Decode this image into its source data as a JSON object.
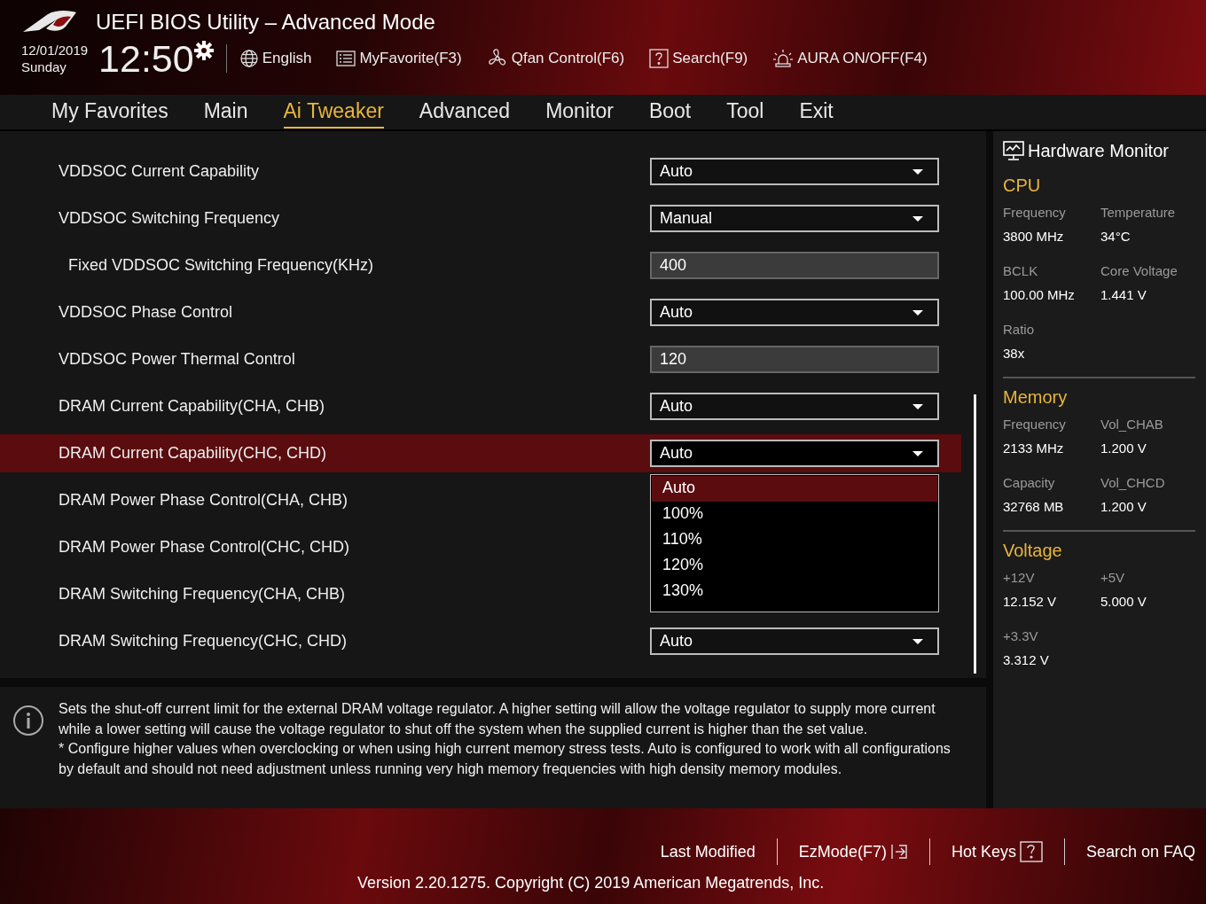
{
  "header": {
    "title": "UEFI BIOS Utility – Advanced Mode",
    "date": "12/01/2019",
    "day": "Sunday",
    "time": "12:50",
    "tools": [
      {
        "label": "English"
      },
      {
        "label": "MyFavorite(F3)"
      },
      {
        "label": "Qfan Control(F6)"
      },
      {
        "label": "Search(F9)"
      },
      {
        "label": "AURA ON/OFF(F4)"
      }
    ]
  },
  "tabs": [
    {
      "label": "My Favorites",
      "selected": false
    },
    {
      "label": "Main",
      "selected": false
    },
    {
      "label": "Ai Tweaker",
      "selected": true
    },
    {
      "label": "Advanced",
      "selected": false
    },
    {
      "label": "Monitor",
      "selected": false
    },
    {
      "label": "Boot",
      "selected": false
    },
    {
      "label": "Tool",
      "selected": false
    },
    {
      "label": "Exit",
      "selected": false
    }
  ],
  "settings": [
    {
      "label": "VDDSOC Current Capability",
      "kind": "dropdown",
      "value": "Auto",
      "selected": false
    },
    {
      "label": "VDDSOC Switching Frequency",
      "kind": "dropdown",
      "value": "Manual",
      "selected": false,
      "children": [
        {
          "label": "Fixed VDDSOC Switching Frequency(KHz)",
          "kind": "number",
          "value": "400",
          "selected": false
        }
      ]
    },
    {
      "label": "VDDSOC Phase Control",
      "kind": "dropdown",
      "value": "Auto",
      "selected": false
    },
    {
      "label": "VDDSOC Power Thermal Control",
      "kind": "number",
      "value": "120",
      "selected": false
    },
    {
      "label": "DRAM Current Capability(CHA, CHB)",
      "kind": "dropdown",
      "value": "Auto",
      "selected": false
    },
    {
      "label": "DRAM Current Capability(CHC, CHD)",
      "kind": "dropdown",
      "value": "Auto",
      "selected": true,
      "options": [
        {
          "label": "Auto",
          "selected": true
        },
        {
          "label": "100%",
          "selected": false
        },
        {
          "label": "110%",
          "selected": false
        },
        {
          "label": "120%",
          "selected": false
        },
        {
          "label": "130%",
          "selected": false
        }
      ]
    },
    {
      "label": "DRAM Power Phase Control(CHA, CHB)",
      "kind": "hidden",
      "selected": false
    },
    {
      "label": "DRAM Power Phase Control(CHC, CHD)",
      "kind": "hidden",
      "selected": false
    },
    {
      "label": "DRAM Switching Frequency(CHA, CHB)",
      "kind": "hidden",
      "selected": false
    },
    {
      "label": "DRAM Switching Frequency(CHC, CHD)",
      "kind": "dropdown",
      "value": "Auto",
      "selected": false
    }
  ],
  "help": [
    "Sets the shut-off current limit for the external DRAM voltage regulator. A higher setting will allow the voltage regulator to supply more current while a lower setting will cause the voltage regulator to shut off the system when the supplied current is higher than the set value.",
    "* Configure higher values when overclocking or when using high current memory stress tests. Auto is configured to work with all configurations by default and should not need adjustment unless running very high memory frequencies with high density memory modules."
  ],
  "hardware_monitor": {
    "title": "Hardware Monitor",
    "sections": [
      {
        "title": "CPU",
        "items": [
          {
            "label": "Frequency",
            "value": "3800 MHz"
          },
          {
            "label": "Temperature",
            "value": "34°C"
          },
          {
            "label": "BCLK",
            "value": "100.00 MHz"
          },
          {
            "label": "Core Voltage",
            "value": "1.441 V"
          },
          {
            "label": "Ratio",
            "value": "38x"
          }
        ]
      },
      {
        "title": "Memory",
        "items": [
          {
            "label": "Frequency",
            "value": "2133 MHz"
          },
          {
            "label": "Vol_CHAB",
            "value": "1.200 V"
          },
          {
            "label": "Capacity",
            "value": "32768 MB"
          },
          {
            "label": "Vol_CHCD",
            "value": "1.200 V"
          }
        ]
      },
      {
        "title": "Voltage",
        "items": [
          {
            "label": "+12V",
            "value": "12.152 V"
          },
          {
            "label": "+5V",
            "value": "5.000 V"
          },
          {
            "label": "+3.3V",
            "value": "3.312 V"
          }
        ]
      }
    ]
  },
  "footer": {
    "links": [
      {
        "label": "Last Modified"
      },
      {
        "label": "EzMode(F7)"
      },
      {
        "label": "Hot Keys"
      },
      {
        "label": "Search on FAQ"
      }
    ],
    "version": "Version 2.20.1275. Copyright (C) 2019 American Megatrends, Inc."
  }
}
